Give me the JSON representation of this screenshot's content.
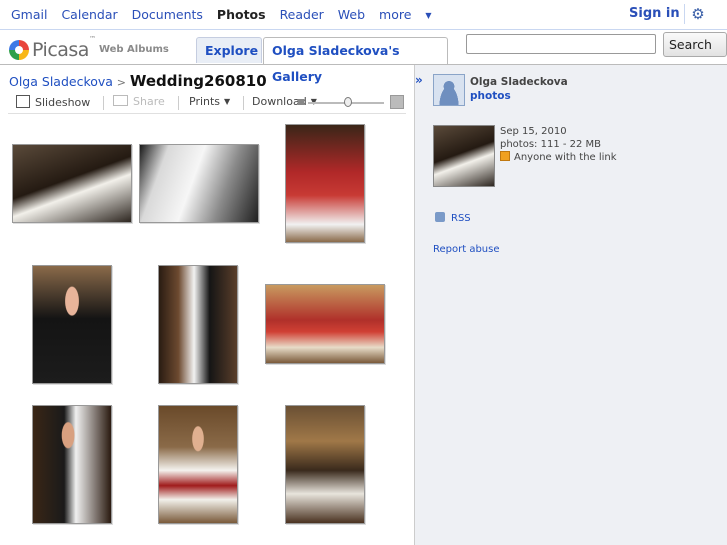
{
  "gbar": {
    "links": [
      "Gmail",
      "Calendar",
      "Documents",
      "Photos",
      "Reader",
      "Web"
    ],
    "more": "more",
    "sign_in": "Sign in",
    "settings_icon": "gear-icon"
  },
  "header": {
    "logo_text": "Picasa",
    "logo_tm": "™",
    "logo_sub": "Web Albums",
    "tabs": [
      "Explore",
      "Olga Sladeckova's Gallery"
    ],
    "search_value": "",
    "search_button": "Search"
  },
  "album": {
    "owner": "Olga Sladeckova",
    "separator": ">",
    "title": "Wedding260810"
  },
  "toolbar": {
    "slideshow": "Slideshow",
    "share": "Share",
    "prints": "Prints",
    "download": "Download"
  },
  "photos": [
    {
      "name": "photo-1",
      "style": "ph-dark"
    },
    {
      "name": "photo-2",
      "style": "ph-bw"
    },
    {
      "name": "photo-3",
      "style": "ph-red"
    },
    {
      "name": "photo-4",
      "style": "ph-groom"
    },
    {
      "name": "photo-5",
      "style": "ph-aisle"
    },
    {
      "name": "photo-6",
      "style": "ph-church"
    },
    {
      "name": "photo-7",
      "style": "ph-groom2"
    },
    {
      "name": "photo-8",
      "style": "ph-bride"
    },
    {
      "name": "photo-9",
      "style": "ph-altar"
    }
  ],
  "sidebar": {
    "collapse": "»",
    "owner_name": "Olga Sladeckova",
    "owner_photos": "photos",
    "date": "Sep 15, 2010",
    "count": "photos: 111 - 22 MB",
    "access": "Anyone with the link",
    "rss": "RSS",
    "report": "Report abuse"
  },
  "colors": {
    "link": "#1f4fc1",
    "sidebar_bg": "#eef0f4",
    "tab_bg": "#e9eef6"
  }
}
